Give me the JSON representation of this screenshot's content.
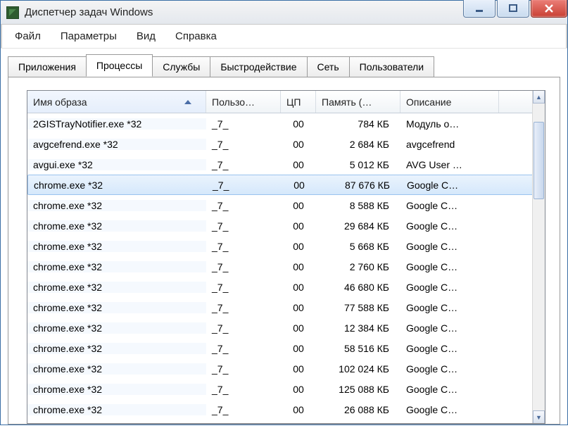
{
  "window": {
    "title": "Диспетчер задач Windows"
  },
  "menu": {
    "file": "Файл",
    "options": "Параметры",
    "view": "Вид",
    "help": "Справка"
  },
  "tabs": {
    "applications": "Приложения",
    "processes": "Процессы",
    "services": "Службы",
    "performance": "Быстродействие",
    "networking": "Сеть",
    "users": "Пользователи"
  },
  "columns": {
    "image_name": "Имя образа",
    "user": "Пользо…",
    "cpu": "ЦП",
    "memory": "Память (…",
    "description": "Описание"
  },
  "rows": [
    {
      "name": "2GISTrayNotifier.exe *32",
      "user": "_7_",
      "cpu": "00",
      "mem": "784 КБ",
      "desc": "Модуль о…",
      "selected": false
    },
    {
      "name": "avgcefrend.exe *32",
      "user": "_7_",
      "cpu": "00",
      "mem": "2 684 КБ",
      "desc": "avgcefrend",
      "selected": false
    },
    {
      "name": "avgui.exe *32",
      "user": "_7_",
      "cpu": "00",
      "mem": "5 012 КБ",
      "desc": "AVG User …",
      "selected": false
    },
    {
      "name": "chrome.exe *32",
      "user": "_7_",
      "cpu": "00",
      "mem": "87 676 КБ",
      "desc": "Google C…",
      "selected": true
    },
    {
      "name": "chrome.exe *32",
      "user": "_7_",
      "cpu": "00",
      "mem": "8 588 КБ",
      "desc": "Google C…",
      "selected": false
    },
    {
      "name": "chrome.exe *32",
      "user": "_7_",
      "cpu": "00",
      "mem": "29 684 КБ",
      "desc": "Google C…",
      "selected": false
    },
    {
      "name": "chrome.exe *32",
      "user": "_7_",
      "cpu": "00",
      "mem": "5 668 КБ",
      "desc": "Google C…",
      "selected": false
    },
    {
      "name": "chrome.exe *32",
      "user": "_7_",
      "cpu": "00",
      "mem": "2 760 КБ",
      "desc": "Google C…",
      "selected": false
    },
    {
      "name": "chrome.exe *32",
      "user": "_7_",
      "cpu": "00",
      "mem": "46 680 КБ",
      "desc": "Google C…",
      "selected": false
    },
    {
      "name": "chrome.exe *32",
      "user": "_7_",
      "cpu": "00",
      "mem": "77 588 КБ",
      "desc": "Google C…",
      "selected": false
    },
    {
      "name": "chrome.exe *32",
      "user": "_7_",
      "cpu": "00",
      "mem": "12 384 КБ",
      "desc": "Google C…",
      "selected": false
    },
    {
      "name": "chrome.exe *32",
      "user": "_7_",
      "cpu": "00",
      "mem": "58 516 КБ",
      "desc": "Google C…",
      "selected": false
    },
    {
      "name": "chrome.exe *32",
      "user": "_7_",
      "cpu": "00",
      "mem": "102 024 КБ",
      "desc": "Google C…",
      "selected": false
    },
    {
      "name": "chrome.exe *32",
      "user": "_7_",
      "cpu": "00",
      "mem": "125 088 КБ",
      "desc": "Google C…",
      "selected": false
    },
    {
      "name": "chrome.exe *32",
      "user": "_7_",
      "cpu": "00",
      "mem": "26 088 КБ",
      "desc": "Google C…",
      "selected": false
    }
  ]
}
